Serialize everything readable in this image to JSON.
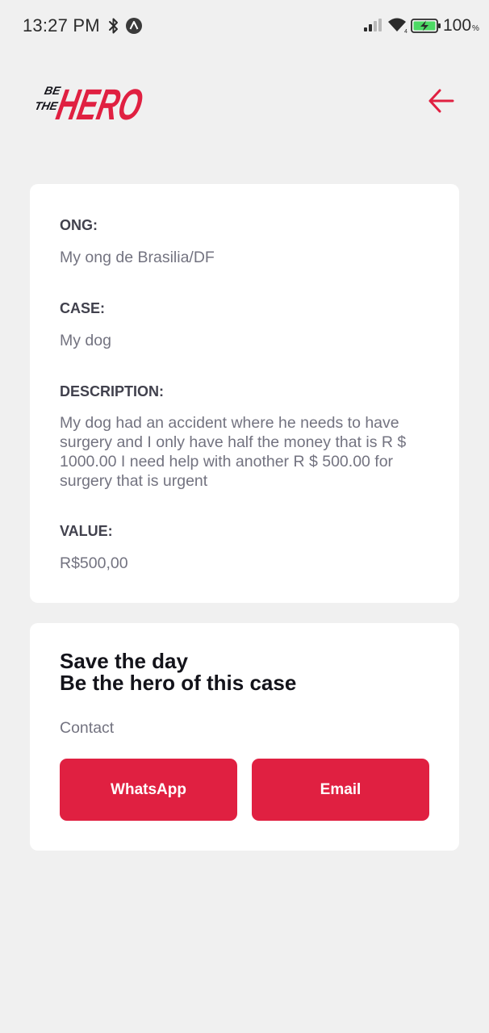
{
  "status_bar": {
    "time": "13:27 PM",
    "battery_level": "100",
    "battery_unit": "%",
    "icons": [
      "bluetooth-icon",
      "app-notification-icon",
      "signal-icon",
      "wifi-icon",
      "battery-charging-icon"
    ]
  },
  "header": {
    "logo_text": {
      "line1": "BE",
      "line2": "THE",
      "main": "HERO"
    },
    "back_icon": "arrow-left-icon"
  },
  "incident": {
    "ong_label": "ONG:",
    "ong_value": "My ong de Brasilia/DF",
    "case_label": "CASE:",
    "case_value": "My dog",
    "description_label": "DESCRIPTION:",
    "description_value": "My dog had an accident where he needs to have surgery and I only have half the money that is R $ 1000.00 I need help with another R $ 500.00 for surgery that is urgent",
    "value_label": "VALUE:",
    "value_value": "R$500,00"
  },
  "contact": {
    "title_line1": "Save the day",
    "title_line2": "Be the hero of this case",
    "label": "Contact",
    "whatsapp_label": "WhatsApp",
    "email_label": "Email"
  },
  "colors": {
    "accent": "#e02041",
    "background": "#f0f0f0",
    "card": "#ffffff",
    "label": "#41414d",
    "value": "#737380",
    "title": "#13131a"
  }
}
